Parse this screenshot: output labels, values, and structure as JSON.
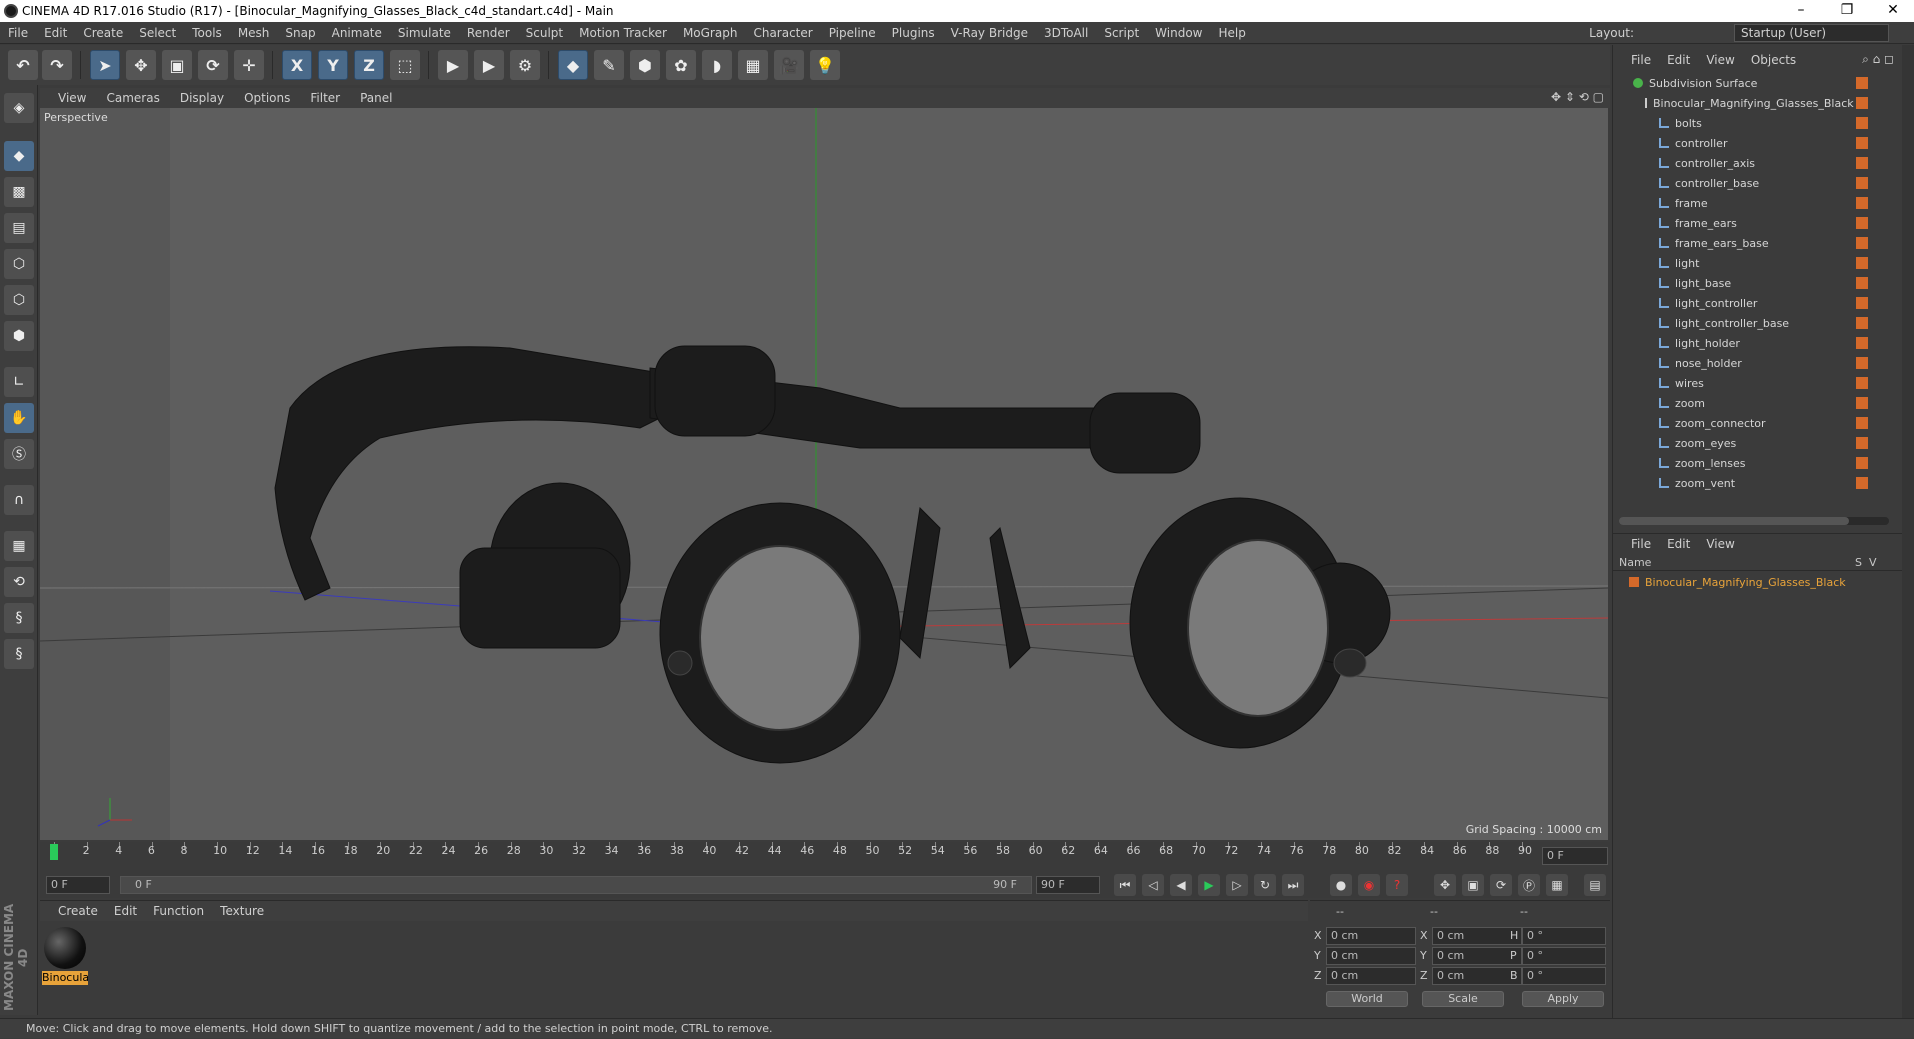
{
  "window": {
    "title": "CINEMA 4D R17.016 Studio (R17) - [Binocular_Magnifying_Glasses_Black_c4d_standart.c4d] - Main",
    "minimize": "–",
    "restore": "❐",
    "close": "✕"
  },
  "menu": [
    "File",
    "Edit",
    "Create",
    "Select",
    "Tools",
    "Mesh",
    "Snap",
    "Animate",
    "Simulate",
    "Render",
    "Sculpt",
    "Motion Tracker",
    "MoGraph",
    "Character",
    "Pipeline",
    "Plugins",
    "V-Ray Bridge",
    "3DToAll",
    "Script",
    "Window",
    "Help"
  ],
  "layout": {
    "label": "Layout:",
    "value": "Startup (User)"
  },
  "toolbar": {
    "x_label": "X",
    "y_label": "Y",
    "z_label": "Z"
  },
  "viewport": {
    "menu": [
      "View",
      "Cameras",
      "Display",
      "Options",
      "Filter",
      "Panel"
    ],
    "camera_label": "Perspective",
    "grid_spacing": "Grid Spacing : 10000 cm"
  },
  "timeline": {
    "ticks": [
      "0",
      "2",
      "4",
      "6",
      "8",
      "10",
      "12",
      "14",
      "16",
      "18",
      "20",
      "22",
      "24",
      "26",
      "28",
      "30",
      "32",
      "34",
      "36",
      "38",
      "40",
      "42",
      "44",
      "46",
      "48",
      "50",
      "52",
      "54",
      "56",
      "58",
      "60",
      "62",
      "64",
      "66",
      "68",
      "70",
      "72",
      "74",
      "76",
      "78",
      "80",
      "82",
      "84",
      "86",
      "88",
      "90"
    ],
    "current_frame": "0 F"
  },
  "playback": {
    "start_field": "0 F",
    "range_start": "0 F",
    "range_end": "90 F",
    "end_field": "90 F"
  },
  "material_panel": {
    "menu": [
      "Create",
      "Edit",
      "Function",
      "Texture"
    ],
    "material_name": "Binocula"
  },
  "coordinates": {
    "headers": [
      "--",
      "--",
      "--"
    ],
    "x_pos": "0 cm",
    "y_pos": "0 cm",
    "z_pos": "0 cm",
    "x_size": "0 cm",
    "y_size": "0 cm",
    "z_size": "0 cm",
    "h_rot": "0 °",
    "p_rot": "0 °",
    "b_rot": "0 °",
    "space": "World",
    "mode": "Scale",
    "apply": "Apply",
    "label_x": "X",
    "label_y": "Y",
    "label_z": "Z",
    "label_h": "H",
    "label_p": "P",
    "label_b": "B"
  },
  "objects_panel": {
    "menu": [
      "File",
      "Edit",
      "View",
      "Objects"
    ],
    "root": "Subdivision Surface",
    "group": "Binocular_Magnifying_Glasses_Black",
    "children": [
      "bolts",
      "controller",
      "controller_axis",
      "controller_base",
      "frame",
      "frame_ears",
      "frame_ears_base",
      "light",
      "light_base",
      "light_controller",
      "light_controller_base",
      "light_holder",
      "nose_holder",
      "wires",
      "zoom",
      "zoom_connector",
      "zoom_eyes",
      "zoom_lenses",
      "zoom_vent"
    ]
  },
  "layers_panel": {
    "menu": [
      "File",
      "Edit",
      "View"
    ],
    "col_name": "Name",
    "col_s": "S",
    "col_v": "V",
    "layer_name": "Binocular_Magnifying_Glasses_Black"
  },
  "status": "Move: Click and drag to move elements. Hold down SHIFT to quantize movement / add to the selection in point mode, CTRL to remove.",
  "branding": "MAXON CINEMA 4D",
  "colors": {
    "accent": "#d4692a",
    "selection": "#e8a33a",
    "tool_blue": "#4a6a8a"
  }
}
